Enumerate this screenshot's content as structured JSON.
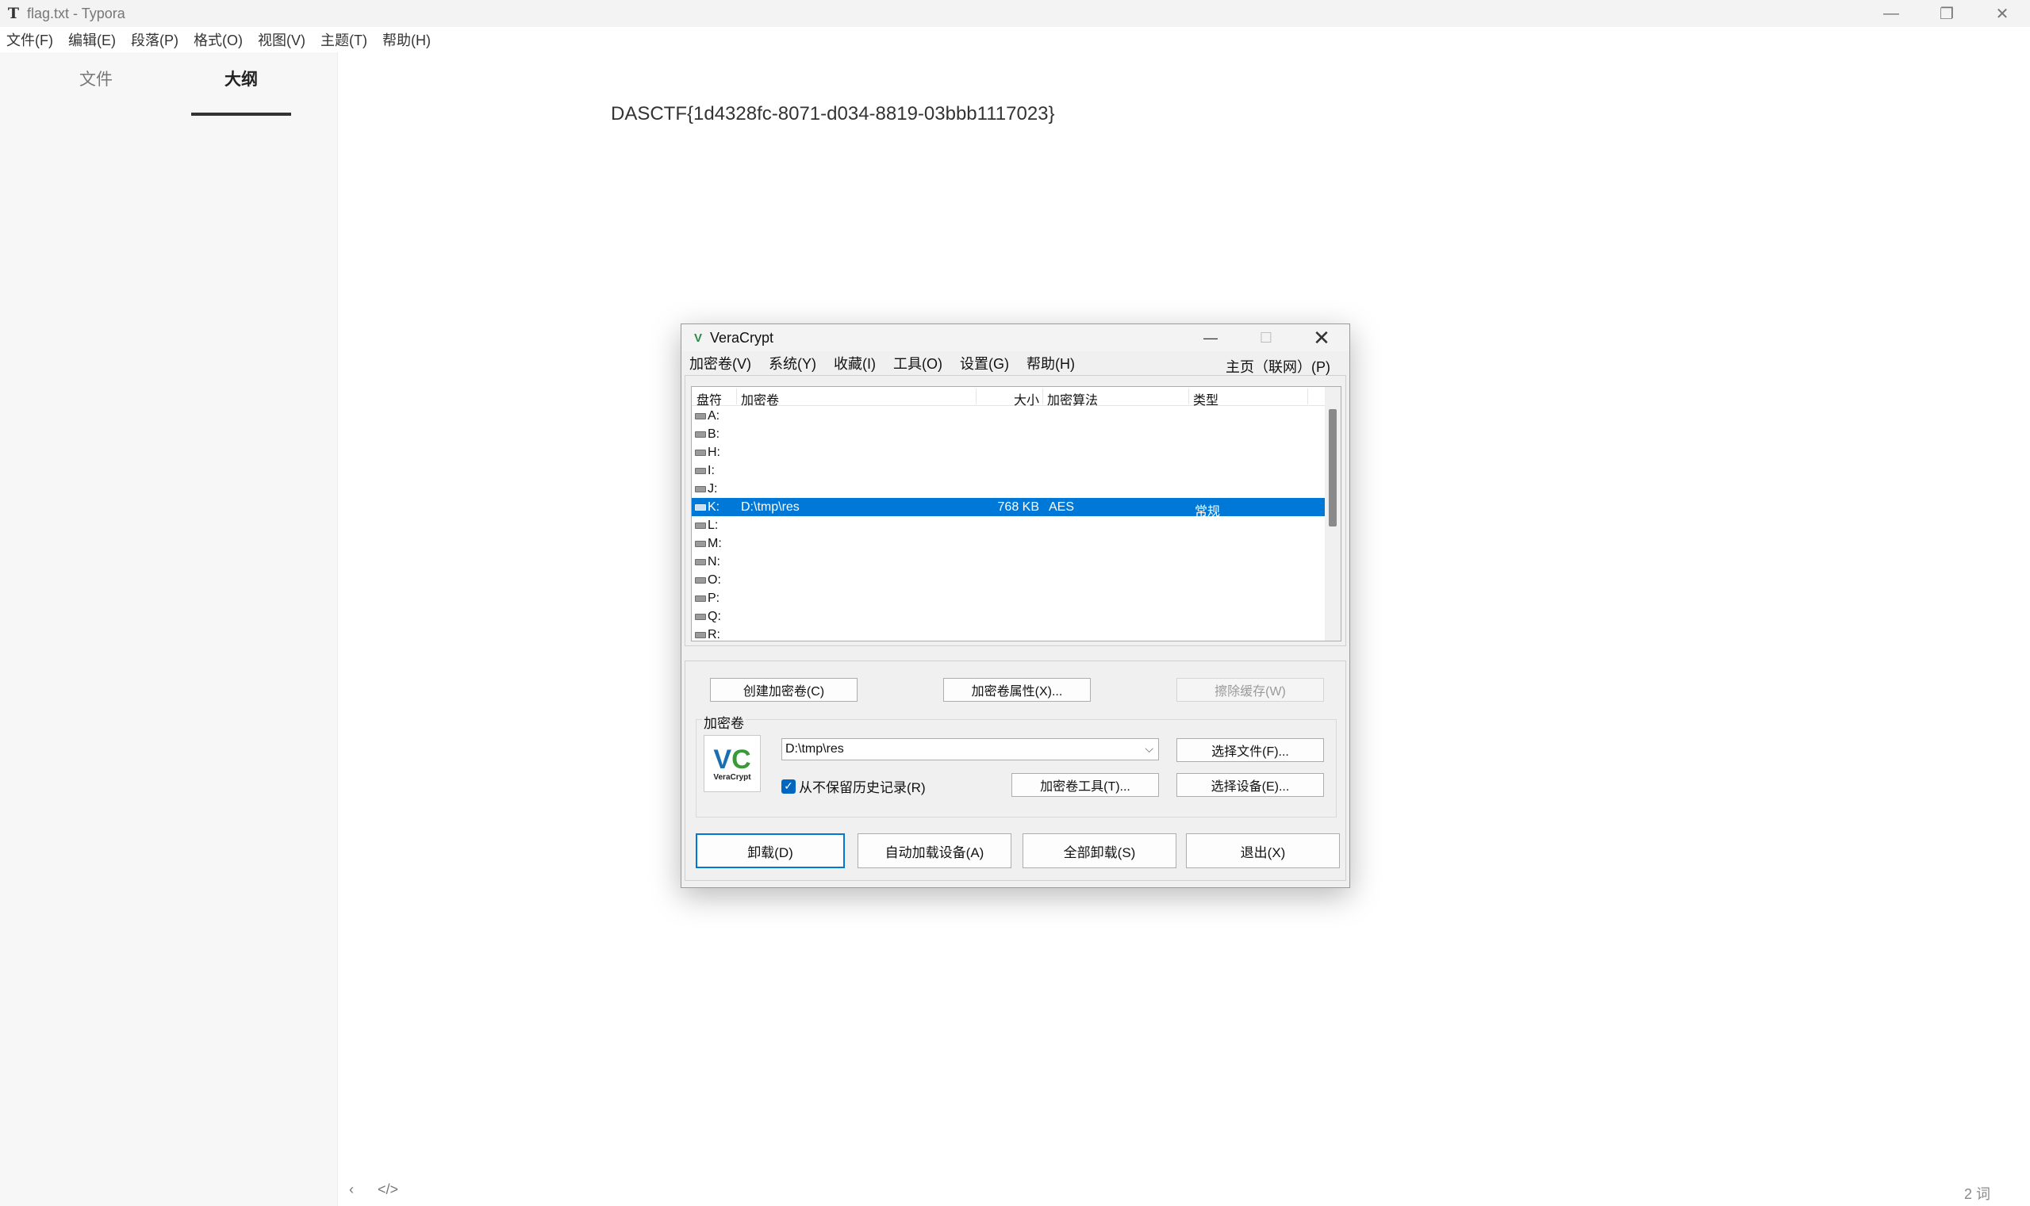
{
  "window": {
    "title": "flag.txt - Typora",
    "app_icon": "T"
  },
  "menubar": [
    "文件(F)",
    "编辑(E)",
    "段落(P)",
    "格式(O)",
    "视图(V)",
    "主题(T)",
    "帮助(H)"
  ],
  "sidebar": {
    "tabs": [
      {
        "label": "文件"
      },
      {
        "label": "大纲"
      }
    ],
    "active_tab": "大纲"
  },
  "document": {
    "content": "DASCTF{1d4328fc-8071-d034-8819-03bbb1117023}"
  },
  "statusbar": {
    "left_icons": [
      "chevron-left-icon",
      "code-icon"
    ],
    "word_count": "2 词"
  },
  "veracrypt": {
    "title": "VeraCrypt",
    "menu": [
      "加密卷(V)",
      "系统(Y)",
      "收藏(I)",
      "工具(O)",
      "设置(G)",
      "帮助(H)"
    ],
    "menu_right": "主页（联网）(P)",
    "columns": [
      "盘符",
      "加密卷",
      "大小",
      "加密算法",
      "类型"
    ],
    "rows": [
      {
        "drive": "A:",
        "volume": "",
        "size": "",
        "algo": "",
        "type": ""
      },
      {
        "drive": "B:",
        "volume": "",
        "size": "",
        "algo": "",
        "type": ""
      },
      {
        "drive": "H:",
        "volume": "",
        "size": "",
        "algo": "",
        "type": ""
      },
      {
        "drive": "I:",
        "volume": "",
        "size": "",
        "algo": "",
        "type": ""
      },
      {
        "drive": "J:",
        "volume": "",
        "size": "",
        "algo": "",
        "type": ""
      },
      {
        "drive": "K:",
        "volume": "D:\\tmp\\res",
        "size": "768 KB",
        "algo": "AES",
        "type": "常规",
        "selected": true
      },
      {
        "drive": "L:",
        "volume": "",
        "size": "",
        "algo": "",
        "type": ""
      },
      {
        "drive": "M:",
        "volume": "",
        "size": "",
        "algo": "",
        "type": ""
      },
      {
        "drive": "N:",
        "volume": "",
        "size": "",
        "algo": "",
        "type": ""
      },
      {
        "drive": "O:",
        "volume": "",
        "size": "",
        "algo": "",
        "type": ""
      },
      {
        "drive": "P:",
        "volume": "",
        "size": "",
        "algo": "",
        "type": ""
      },
      {
        "drive": "Q:",
        "volume": "",
        "size": "",
        "algo": "",
        "type": ""
      },
      {
        "drive": "R:",
        "volume": "",
        "size": "",
        "algo": "",
        "type": ""
      }
    ],
    "buttons": {
      "create": "创建加密卷(C)",
      "properties": "加密卷属性(X)...",
      "wipe_cache": "擦除缓存(W)",
      "select_file": "选择文件(F)...",
      "volume_tools": "加密卷工具(T)...",
      "select_device": "选择设备(E)...",
      "dismount": "卸载(D)",
      "auto_mount": "自动加载设备(A)",
      "dismount_all": "全部卸载(S)",
      "exit": "退出(X)"
    },
    "volume_group_label": "加密卷",
    "volume_path": "D:\\tmp\\res",
    "never_save_history": {
      "label": "从不保留历史记录(R)",
      "checked": true
    },
    "logo_word": "VeraCrypt"
  }
}
